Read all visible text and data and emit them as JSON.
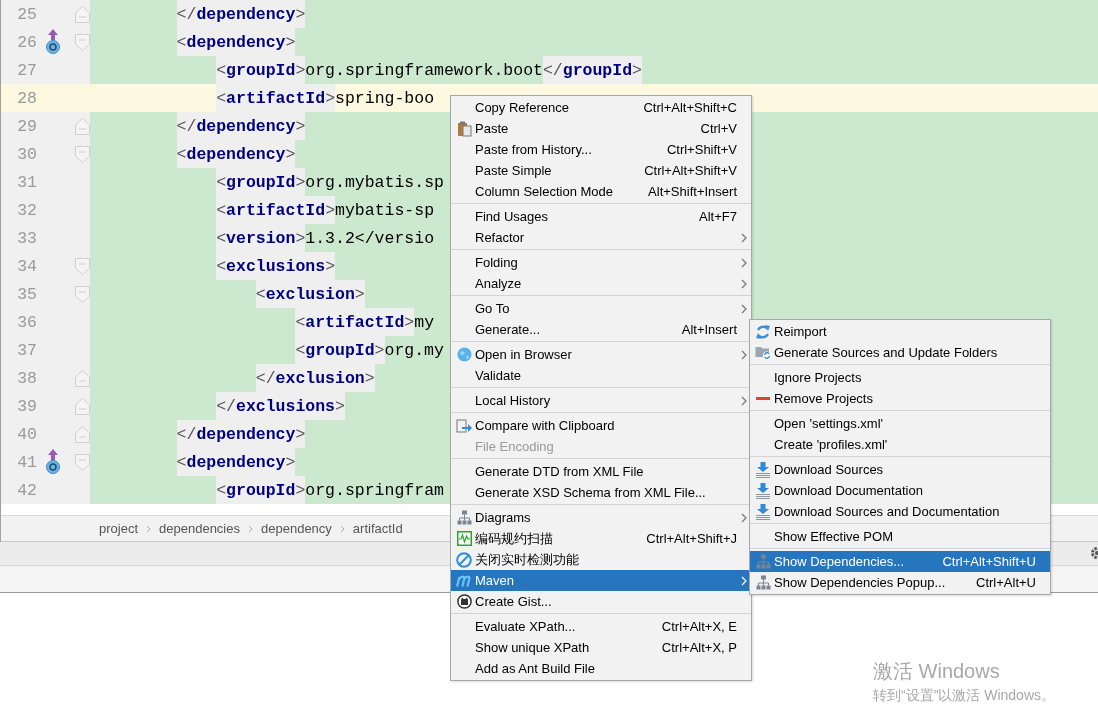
{
  "editor": {
    "lines": [
      {
        "number": "25",
        "text": "    </dependency>",
        "kind": "fold-end",
        "gutter_icon": false,
        "current": false
      },
      {
        "number": "26",
        "text": "    <dependency>",
        "kind": "fold-start",
        "gutter_icon": true,
        "current": false
      },
      {
        "number": "27",
        "text": "        <groupId>org.springframework.boot</groupId>",
        "kind": "plain",
        "gutter_icon": false,
        "current": false
      },
      {
        "number": "28",
        "text": "        <artifactId>spring-boo",
        "kind": "plain",
        "gutter_icon": false,
        "current": true
      },
      {
        "number": "29",
        "text": "    </dependency>",
        "kind": "fold-end",
        "gutter_icon": false,
        "current": false
      },
      {
        "number": "30",
        "text": "    <dependency>",
        "kind": "fold-start",
        "gutter_icon": false,
        "current": false
      },
      {
        "number": "31",
        "text": "        <groupId>org.mybatis.sp",
        "kind": "plain",
        "gutter_icon": false,
        "current": false
      },
      {
        "number": "32",
        "text": "        <artifactId>mybatis-sp",
        "kind": "plain",
        "gutter_icon": false,
        "current": false
      },
      {
        "number": "33",
        "text": "        <version>1.3.2</versio",
        "kind": "plain",
        "gutter_icon": false,
        "current": false
      },
      {
        "number": "34",
        "text": "        <exclusions>",
        "kind": "fold-start",
        "gutter_icon": false,
        "current": false
      },
      {
        "number": "35",
        "text": "            <exclusion>",
        "kind": "fold-start",
        "gutter_icon": false,
        "current": false
      },
      {
        "number": "36",
        "text": "                <artifactId>my",
        "kind": "plain",
        "gutter_icon": false,
        "current": false
      },
      {
        "number": "37",
        "text": "                <groupId>org.my",
        "kind": "plain",
        "gutter_icon": false,
        "current": false
      },
      {
        "number": "38",
        "text": "            </exclusion>",
        "kind": "fold-end",
        "gutter_icon": false,
        "current": false
      },
      {
        "number": "39",
        "text": "        </exclusions>",
        "kind": "fold-end",
        "gutter_icon": false,
        "current": false
      },
      {
        "number": "40",
        "text": "    </dependency>",
        "kind": "fold-end",
        "gutter_icon": false,
        "current": false
      },
      {
        "number": "41",
        "text": "    <dependency>",
        "kind": "fold-start",
        "gutter_icon": true,
        "current": false
      },
      {
        "number": "42",
        "text": "        <groupId>org.springfram",
        "kind": "plain",
        "gutter_icon": false,
        "current": false
      }
    ]
  },
  "breadcrumbs": [
    "project",
    "dependencies",
    "dependency",
    "artifactId"
  ],
  "context_menu": {
    "groups": [
      {
        "items": [
          {
            "label": "Copy Reference",
            "shortcut": "Ctrl+Alt+Shift+C",
            "kind": "plain",
            "submenu": false,
            "disabled": false,
            "selected": false
          },
          {
            "label": "Paste",
            "shortcut": "Ctrl+V",
            "kind": "clipboard",
            "submenu": false,
            "disabled": false,
            "selected": false
          },
          {
            "label": "Paste from History...",
            "shortcut": "Ctrl+Shift+V",
            "kind": "plain",
            "submenu": false,
            "disabled": false,
            "selected": false
          },
          {
            "label": "Paste Simple",
            "shortcut": "Ctrl+Alt+Shift+V",
            "kind": "plain",
            "submenu": false,
            "disabled": false,
            "selected": false
          },
          {
            "label": "Column Selection Mode",
            "shortcut": "Alt+Shift+Insert",
            "kind": "plain",
            "submenu": false,
            "disabled": false,
            "selected": false
          }
        ]
      },
      {
        "items": [
          {
            "label": "Find Usages",
            "shortcut": "Alt+F7",
            "kind": "plain",
            "submenu": false,
            "disabled": false,
            "selected": false
          },
          {
            "label": "Refactor",
            "kind": "plain",
            "submenu": true,
            "disabled": false,
            "selected": false
          }
        ]
      },
      {
        "items": [
          {
            "label": "Folding",
            "kind": "plain",
            "submenu": true,
            "disabled": false,
            "selected": false
          },
          {
            "label": "Analyze",
            "kind": "plain",
            "submenu": true,
            "disabled": false,
            "selected": false
          }
        ]
      },
      {
        "items": [
          {
            "label": "Go To",
            "kind": "plain",
            "submenu": true,
            "disabled": false,
            "selected": false
          },
          {
            "label": "Generate...",
            "shortcut": "Alt+Insert",
            "kind": "plain",
            "submenu": false,
            "disabled": false,
            "selected": false
          }
        ]
      },
      {
        "items": [
          {
            "label": "Open in Browser",
            "kind": "globe",
            "submenu": true,
            "disabled": false,
            "selected": false
          },
          {
            "label": "Validate",
            "kind": "plain",
            "submenu": false,
            "disabled": false,
            "selected": false
          }
        ]
      },
      {
        "items": [
          {
            "label": "Local History",
            "kind": "plain",
            "submenu": true,
            "disabled": false,
            "selected": false
          }
        ]
      },
      {
        "items": [
          {
            "label": "Compare with Clipboard",
            "kind": "compare",
            "submenu": false,
            "disabled": false,
            "selected": false
          },
          {
            "label": "File Encoding",
            "kind": "plain",
            "submenu": false,
            "disabled": true,
            "selected": false
          }
        ]
      },
      {
        "items": [
          {
            "label": "Generate DTD from XML File",
            "kind": "plain",
            "submenu": false,
            "disabled": false,
            "selected": false
          },
          {
            "label": "Generate XSD Schema from XML File...",
            "kind": "plain",
            "submenu": false,
            "disabled": false,
            "selected": false
          }
        ]
      },
      {
        "items": [
          {
            "label": "Diagrams",
            "kind": "hierarchy",
            "submenu": true,
            "disabled": false,
            "selected": false
          },
          {
            "label": "编码规约扫描",
            "shortcut": "Ctrl+Alt+Shift+J",
            "kind": "waveform",
            "submenu": false,
            "disabled": false,
            "selected": false
          },
          {
            "label": "关闭实时检测功能",
            "kind": "prohibited",
            "submenu": false,
            "disabled": false,
            "selected": false
          },
          {
            "label": "Maven",
            "kind": "maven",
            "submenu": true,
            "disabled": false,
            "selected": true
          },
          {
            "label": "Create Gist...",
            "kind": "cat",
            "submenu": false,
            "disabled": false,
            "selected": false
          }
        ]
      },
      {
        "items": [
          {
            "label": "Evaluate XPath...",
            "shortcut": "Ctrl+Alt+X, E",
            "kind": "plain",
            "submenu": false,
            "disabled": false,
            "selected": false
          },
          {
            "label": "Show unique XPath",
            "shortcut": "Ctrl+Alt+X, P",
            "kind": "plain",
            "submenu": false,
            "disabled": false,
            "selected": false
          },
          {
            "label": "Add as Ant Build File",
            "kind": "plain",
            "submenu": false,
            "disabled": false,
            "selected": false
          }
        ]
      }
    ]
  },
  "submenu": {
    "groups": [
      {
        "items": [
          {
            "label": "Reimport",
            "kind": "refresh",
            "submenu": false,
            "disabled": false,
            "selected": false
          },
          {
            "label": "Generate Sources and Update Folders",
            "kind": "folder-refresh",
            "submenu": false,
            "disabled": false,
            "selected": false
          }
        ]
      },
      {
        "items": [
          {
            "label": "Ignore Projects",
            "kind": "plain",
            "submenu": false,
            "disabled": false,
            "selected": false
          },
          {
            "label": "Remove Projects",
            "kind": "minus",
            "submenu": false,
            "disabled": false,
            "selected": false
          }
        ]
      },
      {
        "items": [
          {
            "label": "Open 'settings.xml'",
            "kind": "plain",
            "submenu": false,
            "disabled": false,
            "selected": false
          },
          {
            "label": "Create 'profiles.xml'",
            "kind": "plain",
            "submenu": false,
            "disabled": false,
            "selected": false
          }
        ]
      },
      {
        "items": [
          {
            "label": "Download Sources",
            "kind": "download",
            "submenu": false,
            "disabled": false,
            "selected": false
          },
          {
            "label": "Download Documentation",
            "kind": "download",
            "submenu": false,
            "disabled": false,
            "selected": false
          },
          {
            "label": "Download Sources and Documentation",
            "kind": "download",
            "submenu": false,
            "disabled": false,
            "selected": false
          }
        ]
      },
      {
        "items": [
          {
            "label": "Show Effective POM",
            "kind": "plain",
            "submenu": false,
            "disabled": false,
            "selected": false
          }
        ]
      },
      {
        "items": [
          {
            "label": "Show Dependencies...",
            "shortcut": "Ctrl+Alt+Shift+U",
            "kind": "hierarchy",
            "submenu": false,
            "disabled": false,
            "selected": true
          },
          {
            "label": "Show Dependencies Popup...",
            "shortcut": "Ctrl+Alt+U",
            "kind": "hierarchy",
            "submenu": false,
            "disabled": false,
            "selected": false
          }
        ]
      }
    ]
  },
  "activation_notice": {
    "title": "激活 Windows",
    "hint": "转到“设置”以激活 Windows。"
  }
}
